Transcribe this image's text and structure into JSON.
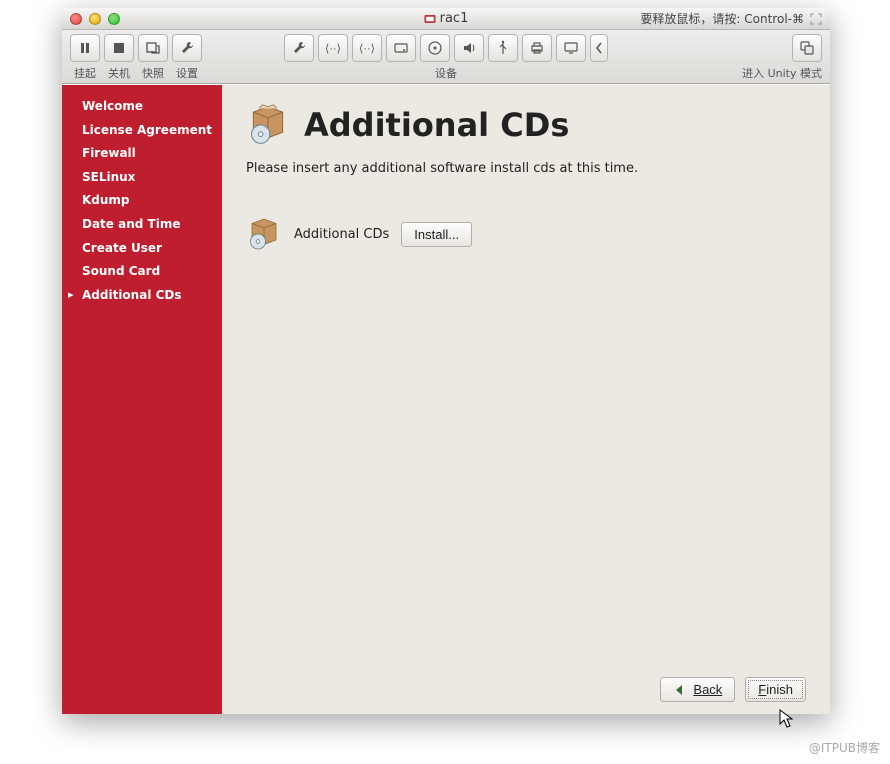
{
  "window": {
    "title": "rac1",
    "release_hint": "要释放鼠标，请按: Control-⌘"
  },
  "toolbar": {
    "left": [
      {
        "name": "suspend-button",
        "label": "挂起",
        "icon": "pause"
      },
      {
        "name": "poweroff-button",
        "label": "关机",
        "icon": "stop"
      },
      {
        "name": "snapshot-button",
        "label": "快照",
        "icon": "snapshot"
      },
      {
        "name": "settings-button",
        "label": "设置",
        "icon": "wrench"
      }
    ],
    "center_label": "设备",
    "center": [
      {
        "name": "device-settings-button",
        "icon": "wrench"
      },
      {
        "name": "net-adapter1-button",
        "icon": "net"
      },
      {
        "name": "net-adapter2-button",
        "icon": "net"
      },
      {
        "name": "hdd-button",
        "icon": "hdd"
      },
      {
        "name": "cd-button",
        "icon": "cd"
      },
      {
        "name": "sound-button",
        "icon": "sound"
      },
      {
        "name": "usb-button",
        "icon": "usb"
      },
      {
        "name": "printer-button",
        "icon": "printer"
      },
      {
        "name": "display-button",
        "icon": "display"
      },
      {
        "name": "menu-chevron-button",
        "icon": "chevron"
      }
    ],
    "right": {
      "name": "unity-button",
      "label": "进入 Unity 模式",
      "icon": "unity"
    }
  },
  "sidebar": {
    "items": [
      {
        "label": "Welcome",
        "active": false
      },
      {
        "label": "License Agreement",
        "active": false
      },
      {
        "label": "Firewall",
        "active": false
      },
      {
        "label": "SELinux",
        "active": false
      },
      {
        "label": "Kdump",
        "active": false
      },
      {
        "label": "Date and Time",
        "active": false
      },
      {
        "label": "Create User",
        "active": false
      },
      {
        "label": "Sound Card",
        "active": false
      },
      {
        "label": "Additional CDs",
        "active": true
      }
    ]
  },
  "main": {
    "title": "Additional CDs",
    "subtitle": "Please insert any additional software install cds at this time.",
    "row_label": "Additional CDs",
    "install_button": "Install...",
    "back_button": "Back",
    "finish_button": "Finish"
  },
  "watermark": "@ITPUB博客"
}
